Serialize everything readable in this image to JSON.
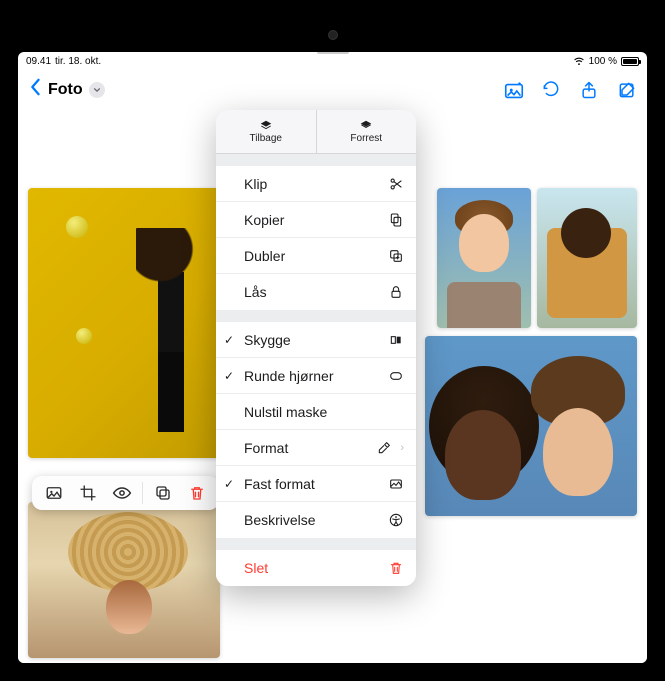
{
  "status": {
    "time": "09.41",
    "date": "tir. 18. okt.",
    "battery_pct": "100 %"
  },
  "toolbar": {
    "title": "Foto",
    "icons": {
      "media": "media-insert",
      "undo": "undo",
      "share": "share",
      "compose": "compose"
    }
  },
  "float_toolbar": {
    "items": [
      "image",
      "crop",
      "eye",
      "duplicate",
      "delete"
    ]
  },
  "popover": {
    "tabs": {
      "back": "Tilbage",
      "front": "Forrest"
    },
    "group1": {
      "cut": "Klip",
      "copy": "Kopier",
      "duplicate": "Dubler",
      "lock": "Lås"
    },
    "group2": {
      "shadow": "Skygge",
      "rounded": "Runde hjørner",
      "reset_mask": "Nulstil maske",
      "format": "Format",
      "fixed_format": "Fast format",
      "description": "Beskrivelse"
    },
    "group3": {
      "delete": "Slet"
    },
    "checked": {
      "shadow": true,
      "rounded": true,
      "fixed_format": true
    }
  }
}
